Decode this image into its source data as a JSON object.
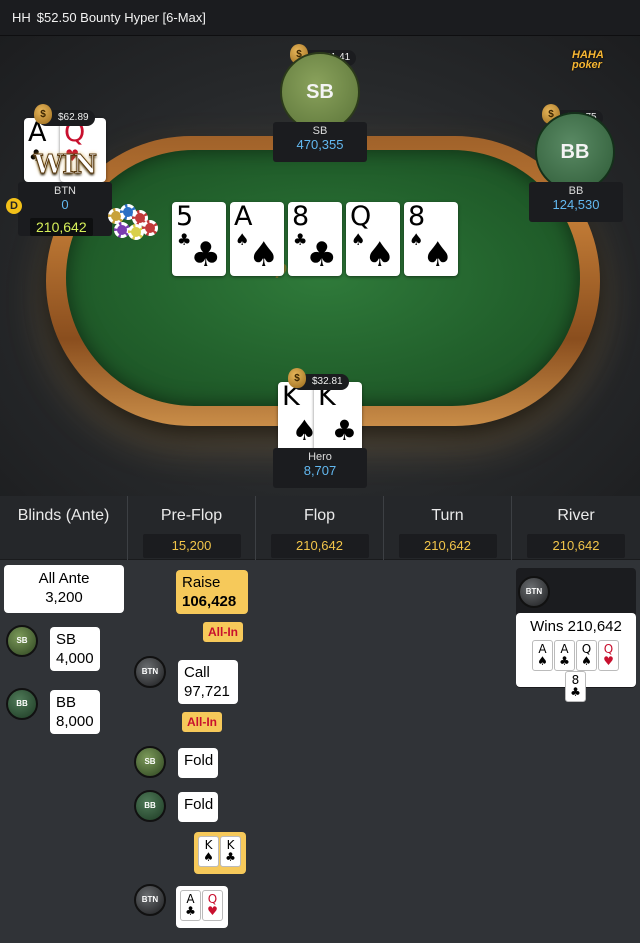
{
  "header": {
    "hh": "HH",
    "title": "$52.50 Bounty Hyper [6-Max]"
  },
  "logo": {
    "line1": "HAHA",
    "line2": "poker"
  },
  "felt_logo": "poker",
  "seats": {
    "sb": {
      "initials": "SB",
      "name": "SB",
      "stack": "470,355",
      "bounty": "$141.41"
    },
    "bb": {
      "initials": "BB",
      "name": "BB",
      "stack": "124,530",
      "bounty": "$68.75"
    },
    "btn": {
      "name": "BTN",
      "stack": "0",
      "bet": "210,642",
      "bounty": "$62.89",
      "win": "WIN",
      "dealer": "D",
      "cards": [
        {
          "rank": "A",
          "suit": "♣",
          "red": false
        },
        {
          "rank": "Q",
          "suit": "♥",
          "red": true
        }
      ]
    },
    "hero": {
      "name": "Hero",
      "stack": "8,707",
      "bounty": "$32.81",
      "cards": [
        {
          "rank": "K",
          "suit": "♠",
          "red": false
        },
        {
          "rank": "K",
          "suit": "♣",
          "red": false
        }
      ]
    }
  },
  "board": [
    {
      "rank": "5",
      "suit": "♣",
      "red": false
    },
    {
      "rank": "A",
      "suit": "♠",
      "red": false
    },
    {
      "rank": "8",
      "suit": "♣",
      "red": false
    },
    {
      "rank": "Q",
      "suit": "♠",
      "red": false
    },
    {
      "rank": "8",
      "suit": "♠",
      "red": false
    }
  ],
  "streets": [
    {
      "label": "Blinds (Ante)",
      "pot": ""
    },
    {
      "label": "Pre-Flop",
      "pot": "15,200"
    },
    {
      "label": "Flop",
      "pot": "210,642"
    },
    {
      "label": "Turn",
      "pot": "210,642"
    },
    {
      "label": "River",
      "pot": "210,642"
    }
  ],
  "blinds": {
    "ante_label": "All Ante",
    "ante_value": "3,200",
    "sb_badge": "SB",
    "sb_label": "SB",
    "sb_value": "4,000",
    "bb_badge": "BB",
    "bb_label": "BB",
    "bb_value": "8,000"
  },
  "preflop": {
    "raise_label": "Raise",
    "raise_value": "106,428",
    "allin1": "All-In",
    "call_badge": "BTN",
    "call_label": "Call",
    "call_value": "97,721",
    "allin2": "All-In",
    "fold1_badge": "SB",
    "fold1_label": "Fold",
    "fold2_badge": "BB",
    "fold2_label": "Fold",
    "hero_cards": [
      {
        "rank": "K",
        "suit": "♠",
        "red": false
      },
      {
        "rank": "K",
        "suit": "♣",
        "red": false
      }
    ],
    "show_badge": "BTN",
    "btn_cards": [
      {
        "rank": "A",
        "suit": "♣",
        "red": false
      },
      {
        "rank": "Q",
        "suit": "♥",
        "red": true
      }
    ]
  },
  "river": {
    "badge": "BTN",
    "wins_label": "Wins 210,642",
    "cards": [
      {
        "rank": "A",
        "suit": "♠",
        "red": false
      },
      {
        "rank": "A",
        "suit": "♣",
        "red": false
      },
      {
        "rank": "Q",
        "suit": "♠",
        "red": false
      },
      {
        "rank": "Q",
        "suit": "♥",
        "red": true
      },
      {
        "rank": "8",
        "suit": "♣",
        "red": false
      }
    ]
  }
}
